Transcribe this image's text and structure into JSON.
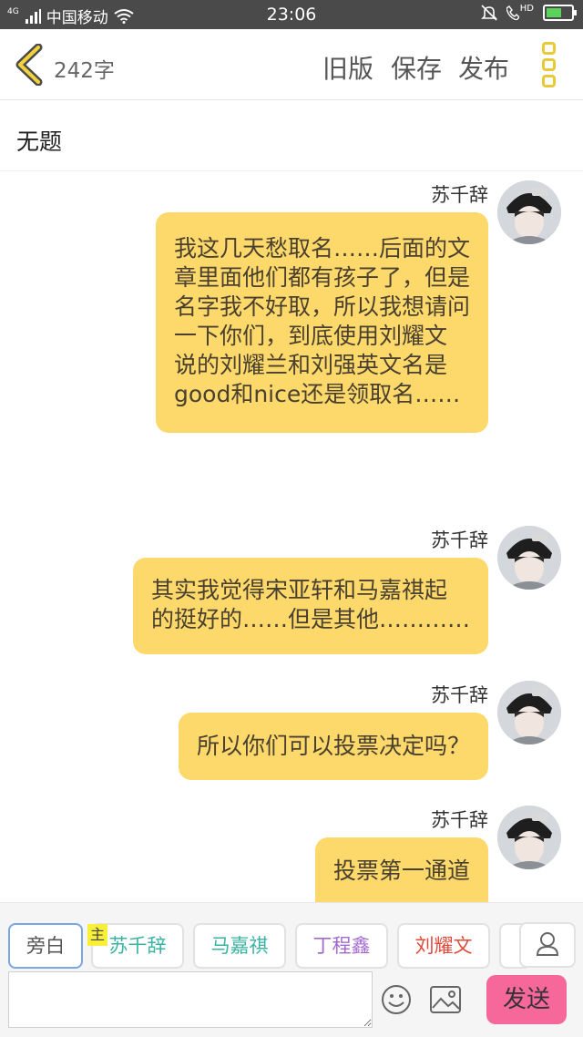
{
  "status": {
    "net_label": "4G",
    "carrier": "中国移动",
    "time": "23:06",
    "hd_label": "HD"
  },
  "header": {
    "word_count": "242字",
    "old_version": "旧版",
    "save": "保存",
    "publish": "发布"
  },
  "title": "无题",
  "messages": [
    {
      "sender": "苏千辞",
      "lines": [
        "我这几天愁取名……后面的文",
        "章里面他们都有孩子了，但是",
        "名字我不好取，所以我想请问",
        "一下你们，到底使用刘耀文",
        "说的刘耀兰和刘强英文名是",
        "good和nice还是领取名……"
      ]
    },
    {
      "sender": "苏千辞",
      "lines": [
        "其实我觉得宋亚轩和马嘉祺起",
        "的挺好的……但是其他…………"
      ]
    },
    {
      "sender": "苏千辞",
      "lines": [
        "所以你们可以投票决定吗？"
      ]
    },
    {
      "sender": "苏千辞",
      "lines": [
        "投票第一通道"
      ]
    }
  ],
  "roles": {
    "narrator": "旁白",
    "main_tag": "主",
    "su": "苏千辞",
    "ma": "马嘉祺",
    "ding": "丁程鑫",
    "liu": "刘耀文"
  },
  "input": {
    "placeholder": "",
    "send": "发送"
  },
  "colors": {
    "bubble": "#fcd96a",
    "accent_yellow": "#e9c93a",
    "send_button": "#f6679a",
    "status_bar": "#4a4a4a"
  }
}
